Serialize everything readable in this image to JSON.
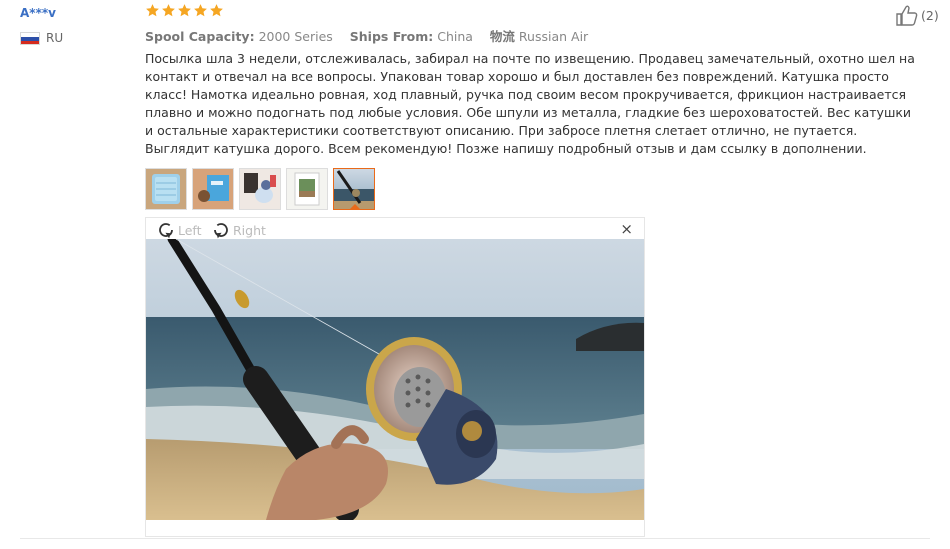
{
  "reviewer": {
    "name": "A***v",
    "country": "RU"
  },
  "rating": {
    "stars": 5,
    "max": 5,
    "color": "#f5a623"
  },
  "meta": {
    "spool_label": "Spool Capacity:",
    "spool_value": "2000 Series",
    "ships_label": "Ships From:",
    "ships_value": "China",
    "logistics_label": "物流",
    "logistics_value": "Russian Air"
  },
  "review_text": "Посылка шла 3 недели, отслеживалась, забирал на почте по извещению. Продавец замечательный, охотно шел на контакт и отвечал на все вопросы. Упакован товар хорошо и был доставлен без повреждений. Катушка просто класс! Намотка идеально ровная, ход плавный, ручка под своим весом прокручивается, фрикцион настраивается плавно и можно подогнать под любые условия. Обе шпули из металла, гладкие без шероховатостей. Вес катушки и остальные характеристики соответствуют описанию. При забросе плетня слетает отлично, не путается. Выглядит катушка дорого. Всем рекомендую! Позже напишу подробный отзыв и дам ссылку в дополнении.",
  "viewer": {
    "rotate_left_label": "Left",
    "rotate_right_label": "Right",
    "close_label": "×"
  },
  "helpful": {
    "count": "(2)",
    "icon": "thumbs-up-icon"
  },
  "thumbnails": {
    "count": 5,
    "active_index": 4
  },
  "colors": {
    "accent": "#e96a1a",
    "name_link": "#3a6fc4"
  }
}
